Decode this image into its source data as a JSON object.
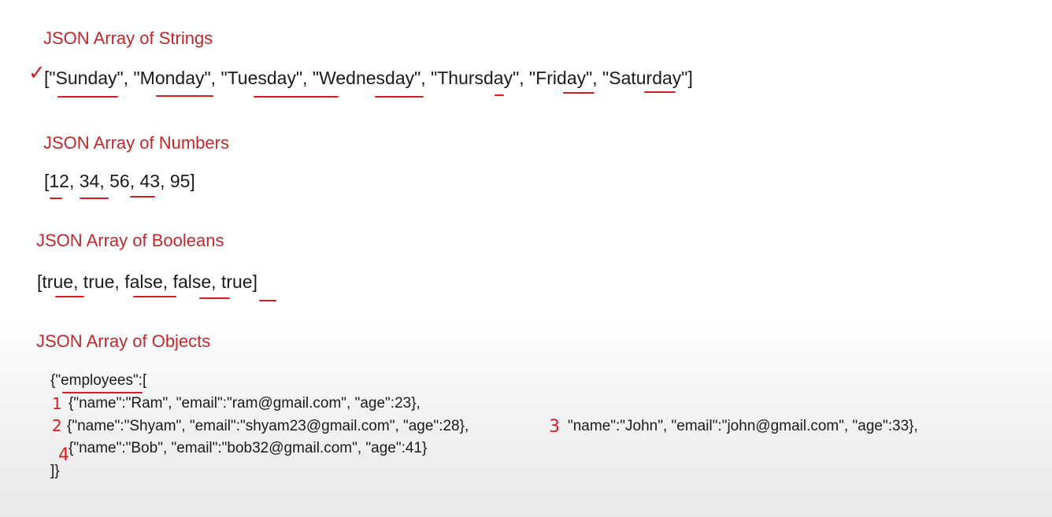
{
  "sections": {
    "strings": {
      "heading": "JSON Array of Strings",
      "example": "[\"Sunday\", \"Monday\", \"Tuesday\", \"Wednesday\", \"Thursday\", \"Friday\", \"Saturday\"]"
    },
    "numbers": {
      "heading": "JSON Array of Numbers",
      "example": "[12, 34, 56, 43, 95]"
    },
    "booleans": {
      "heading": "JSON Array of Booleans",
      "example": "[true, true, false, false, true]"
    },
    "objects": {
      "heading": "JSON Array of Objects",
      "lines": [
        "{\"employees\":[",
        "{\"name\":\"Ram\", \"email\":\"ram@gmail.com\", \"age\":23},",
        "{\"name\":\"Shyam\", \"email\":\"shyam23@gmail.com\", \"age\":28},",
        "\"name\":\"John\", \"email\":\"john@gmail.com\", \"age\":33},",
        "{\"name\":\"Bob\", \"email\":\"bob32@gmail.com\", \"age\":41}",
        "]}"
      ]
    }
  },
  "annotations": {
    "color": "#d21f1f",
    "checkmark": "✓",
    "counters": [
      "1",
      "2",
      "3",
      "4"
    ]
  }
}
